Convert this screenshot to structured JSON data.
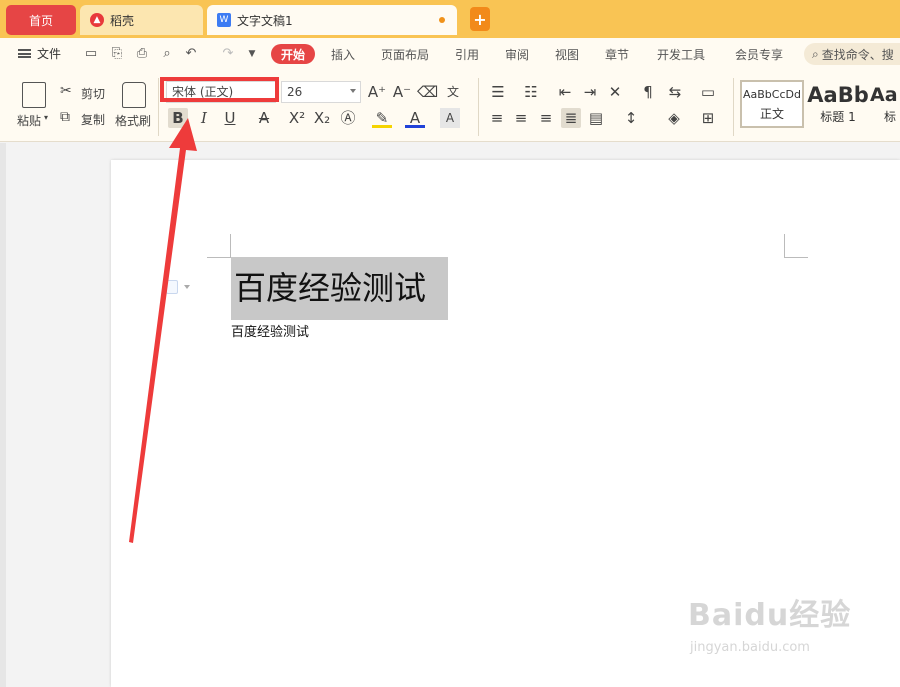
{
  "tabs": {
    "home": "首页",
    "daoke": "稻壳",
    "doc": "文字文稿1"
  },
  "menu": {
    "file": "文件",
    "items": [
      "开始",
      "插入",
      "页面布局",
      "引用",
      "审阅",
      "视图",
      "章节",
      "开发工具",
      "会员专享"
    ],
    "search_placeholder": "查找命令、搜"
  },
  "ribbon": {
    "paste": "粘贴",
    "cut": "剪切",
    "copy": "复制",
    "format_painter": "格式刷",
    "font_name": "宋体 (正文)",
    "font_size": "26",
    "styles": [
      {
        "sample": "AaBbCcDd",
        "name": "正文"
      },
      {
        "sample": "AaBb",
        "name": "标题 1"
      },
      {
        "sample": "Aa",
        "name": "标题"
      }
    ]
  },
  "document": {
    "heading": "百度经验测试",
    "body": "百度经验测试"
  },
  "watermark": {
    "logo": "Baidu经验",
    "url": "jingyan.baidu.com"
  },
  "colors": {
    "tabbar": "#f9c454",
    "accent_red": "#e64545",
    "annotation_red": "#ee3b3b",
    "selection_gray": "#c8c8c8"
  }
}
